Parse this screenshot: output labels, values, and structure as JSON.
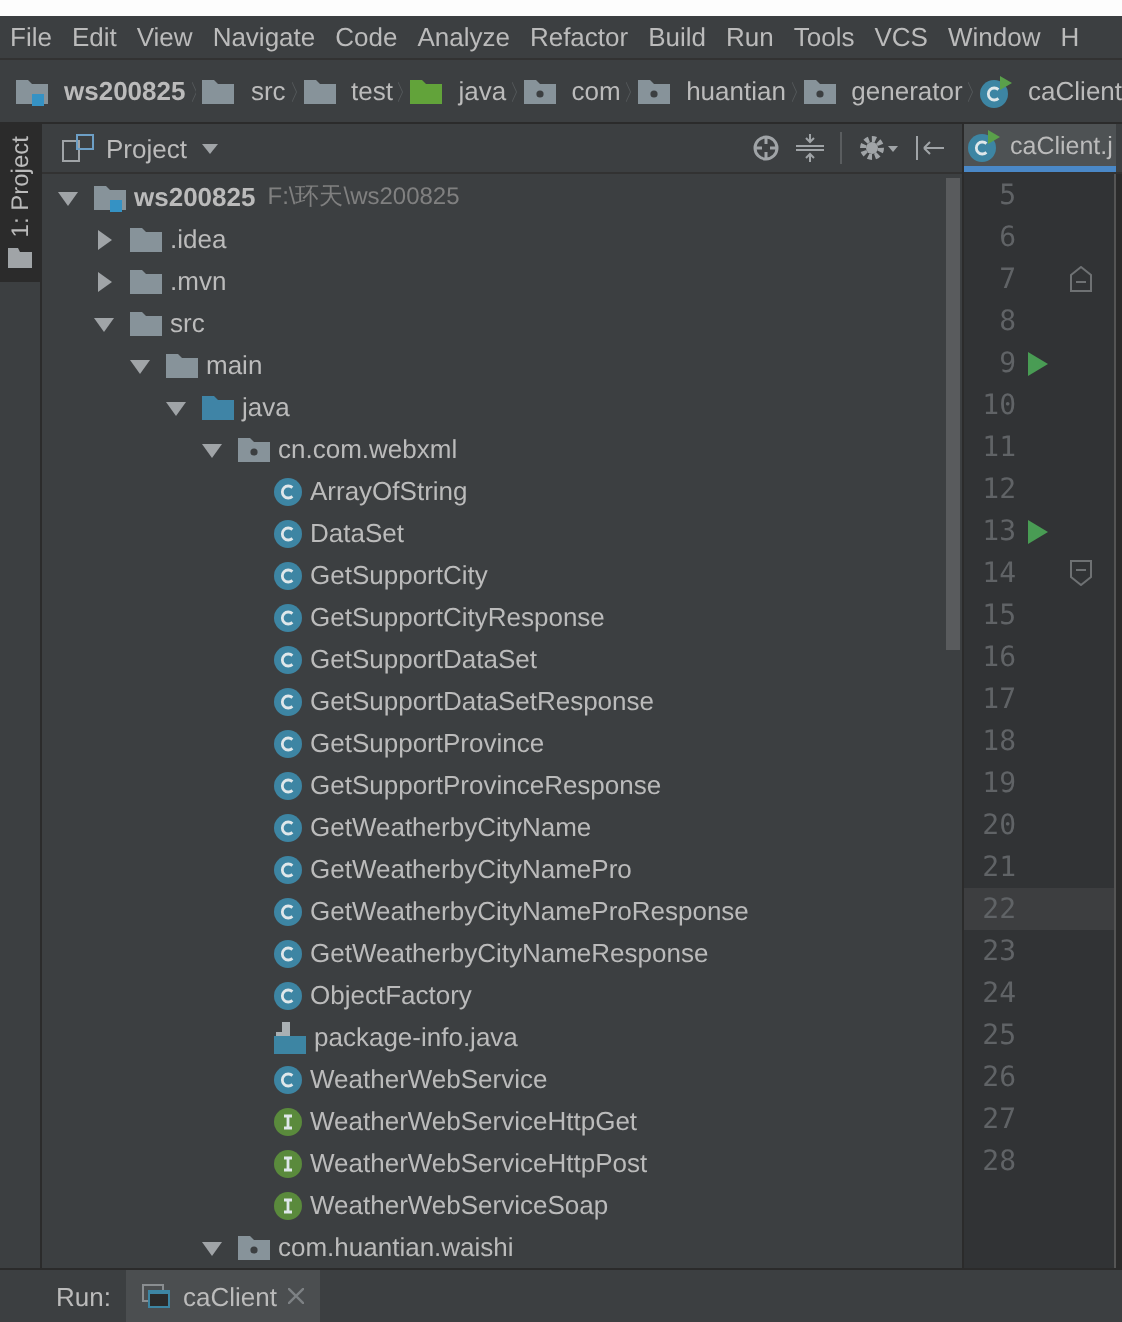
{
  "menu": [
    "File",
    "Edit",
    "View",
    "Navigate",
    "Code",
    "Analyze",
    "Refactor",
    "Build",
    "Run",
    "Tools",
    "VCS",
    "Window",
    "H"
  ],
  "breadcrumbs": [
    {
      "label": "ws200825",
      "kind": "module"
    },
    {
      "label": "src",
      "kind": "folder"
    },
    {
      "label": "test",
      "kind": "folder"
    },
    {
      "label": "java",
      "kind": "testroot"
    },
    {
      "label": "com",
      "kind": "package"
    },
    {
      "label": "huantian",
      "kind": "package"
    },
    {
      "label": "generator",
      "kind": "package"
    },
    {
      "label": "caClient",
      "kind": "runclass"
    }
  ],
  "tool_stripe": {
    "label": "1: Project"
  },
  "project_panel": {
    "title": "Project",
    "tree": [
      {
        "label": "ws200825",
        "kind": "module",
        "path": "F:\\环天\\ws200825",
        "expanded": true,
        "children": [
          {
            "label": ".idea",
            "kind": "folder",
            "expanded": false
          },
          {
            "label": ".mvn",
            "kind": "folder",
            "expanded": false
          },
          {
            "label": "src",
            "kind": "folder",
            "expanded": true,
            "children": [
              {
                "label": "main",
                "kind": "folder",
                "expanded": true,
                "children": [
                  {
                    "label": "java",
                    "kind": "sourceroot",
                    "expanded": true,
                    "children": [
                      {
                        "label": "cn.com.webxml",
                        "kind": "package",
                        "expanded": true,
                        "children": [
                          {
                            "label": "ArrayOfString",
                            "kind": "class"
                          },
                          {
                            "label": "DataSet",
                            "kind": "class"
                          },
                          {
                            "label": "GetSupportCity",
                            "kind": "class"
                          },
                          {
                            "label": "GetSupportCityResponse",
                            "kind": "class"
                          },
                          {
                            "label": "GetSupportDataSet",
                            "kind": "class"
                          },
                          {
                            "label": "GetSupportDataSetResponse",
                            "kind": "class"
                          },
                          {
                            "label": "GetSupportProvince",
                            "kind": "class"
                          },
                          {
                            "label": "GetSupportProvinceResponse",
                            "kind": "class"
                          },
                          {
                            "label": "GetWeatherbyCityName",
                            "kind": "class"
                          },
                          {
                            "label": "GetWeatherbyCityNamePro",
                            "kind": "class"
                          },
                          {
                            "label": "GetWeatherbyCityNameProResponse",
                            "kind": "class"
                          },
                          {
                            "label": "GetWeatherbyCityNameResponse",
                            "kind": "class"
                          },
                          {
                            "label": "ObjectFactory",
                            "kind": "class"
                          },
                          {
                            "label": "package-info.java",
                            "kind": "javafile"
                          },
                          {
                            "label": "WeatherWebService",
                            "kind": "class"
                          },
                          {
                            "label": "WeatherWebServiceHttpGet",
                            "kind": "interface"
                          },
                          {
                            "label": "WeatherWebServiceHttpPost",
                            "kind": "interface"
                          },
                          {
                            "label": "WeatherWebServiceSoap",
                            "kind": "interface"
                          }
                        ]
                      },
                      {
                        "label": "com.huantian.waishi",
                        "kind": "package",
                        "expanded": true
                      }
                    ]
                  }
                ]
              }
            ]
          }
        ]
      }
    ]
  },
  "editor": {
    "tab": {
      "label": "caClient.j",
      "selected": true
    },
    "lines": [
      {
        "number": "5",
        "kind": "plain",
        "current": false
      },
      {
        "number": "6",
        "kind": "plain",
        "current": false
      },
      {
        "number": "7",
        "kind": "foldstart",
        "current": false
      },
      {
        "number": "8",
        "kind": "plain",
        "current": false
      },
      {
        "number": "9",
        "kind": "runnable",
        "current": false
      },
      {
        "number": "10",
        "kind": "plain",
        "current": false
      },
      {
        "number": "11",
        "kind": "plain",
        "current": false
      },
      {
        "number": "12",
        "kind": "plain",
        "current": false
      },
      {
        "number": "13",
        "kind": "runnable",
        "current": false
      },
      {
        "number": "14",
        "kind": "foldend",
        "current": false
      },
      {
        "number": "15",
        "kind": "plain",
        "current": false
      },
      {
        "number": "16",
        "kind": "plain",
        "current": false
      },
      {
        "number": "17",
        "kind": "plain",
        "current": false
      },
      {
        "number": "18",
        "kind": "plain",
        "current": false
      },
      {
        "number": "19",
        "kind": "plain",
        "current": false
      },
      {
        "number": "20",
        "kind": "plain",
        "current": false
      },
      {
        "number": "21",
        "kind": "plain",
        "current": false
      },
      {
        "number": "22",
        "kind": "plain",
        "current": true
      },
      {
        "number": "23",
        "kind": "plain",
        "current": false
      },
      {
        "number": "24",
        "kind": "plain",
        "current": false
      },
      {
        "number": "25",
        "kind": "plain",
        "current": false
      },
      {
        "number": "26",
        "kind": "plain",
        "current": false
      },
      {
        "number": "27",
        "kind": "plain",
        "current": false
      },
      {
        "number": "28",
        "kind": "plain",
        "current": false
      }
    ]
  },
  "run_bar": {
    "label": "Run:",
    "tab": "caClient"
  }
}
